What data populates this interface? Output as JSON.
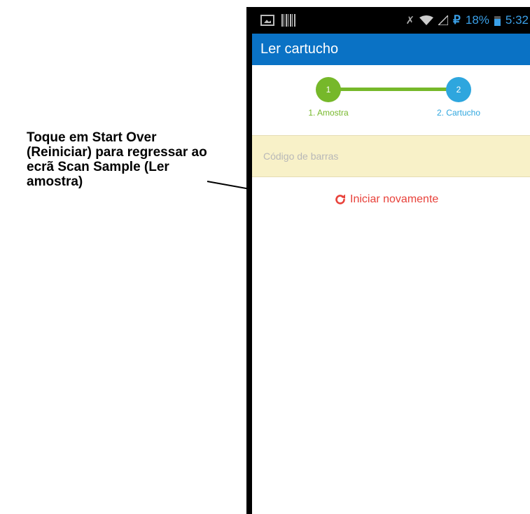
{
  "annotation": {
    "text": "Toque em Start Over (Reiniciar) para regressar ao ecrã Scan Sample (Ler amostra)"
  },
  "status_bar": {
    "battery": "18%",
    "time": "5:32"
  },
  "app_bar": {
    "title": "Ler cartucho"
  },
  "stepper": {
    "steps": [
      {
        "number": "1",
        "label": "1. Amostra"
      },
      {
        "number": "2",
        "label": "2. Cartucho"
      }
    ]
  },
  "barcode_field": {
    "placeholder": "Código de barras"
  },
  "restart": {
    "label": "Iniciar novamente"
  },
  "colors": {
    "app_bar": "#0a72c5",
    "step_done": "#76b82a",
    "step_current": "#2ea6de",
    "field_bg": "#f8f1c8",
    "restart": "#e8413a"
  }
}
